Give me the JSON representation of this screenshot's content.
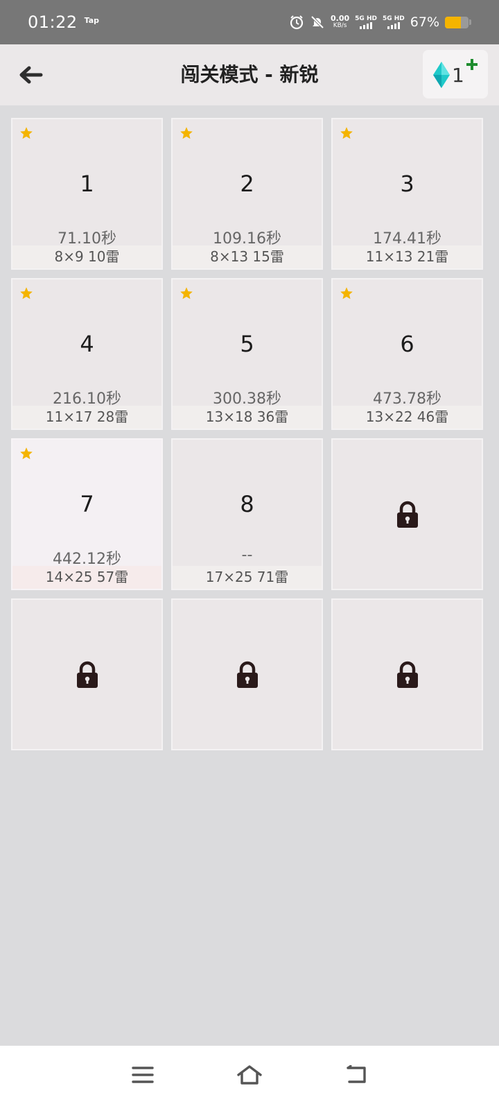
{
  "status_bar": {
    "time": "01:22",
    "app_tag": "Tap",
    "net_speed_value": "0.00",
    "net_speed_unit": "KB/s",
    "sim1_label": "5G HD",
    "sim2_label": "5G HD",
    "battery_percent": "67%",
    "battery_level": 0.67,
    "battery_color": "#f5b400",
    "icons": [
      "alarm-icon",
      "mute-bell-icon",
      "signal-icon",
      "battery-icon"
    ]
  },
  "header": {
    "back_icon": "arrow-left-icon",
    "title": "闯关模式 - 新锐",
    "gem_count": "1",
    "gem_icon": "diamond-icon",
    "gem_color": "#1fc9c9",
    "plus_icon": "plus-icon",
    "plus_color": "#1e8c2e"
  },
  "levels": [
    {
      "num": "1",
      "time": "71.10秒",
      "spec": "8×9  10雷",
      "starred": true,
      "locked": false,
      "active": false
    },
    {
      "num": "2",
      "time": "109.16秒",
      "spec": "8×13  15雷",
      "starred": true,
      "locked": false,
      "active": false
    },
    {
      "num": "3",
      "time": "174.41秒",
      "spec": "11×13  21雷",
      "starred": true,
      "locked": false,
      "active": false
    },
    {
      "num": "4",
      "time": "216.10秒",
      "spec": "11×17  28雷",
      "starred": true,
      "locked": false,
      "active": false
    },
    {
      "num": "5",
      "time": "300.38秒",
      "spec": "13×18  36雷",
      "starred": true,
      "locked": false,
      "active": false
    },
    {
      "num": "6",
      "time": "473.78秒",
      "spec": "13×22  46雷",
      "starred": true,
      "locked": false,
      "active": false
    },
    {
      "num": "7",
      "time": "442.12秒",
      "spec": "14×25  57雷",
      "starred": true,
      "locked": false,
      "active": true
    },
    {
      "num": "8",
      "time": "--",
      "spec": "17×25  71雷",
      "starred": false,
      "locked": false,
      "active": false
    },
    {
      "num": "",
      "time": "",
      "spec": "",
      "starred": false,
      "locked": true,
      "active": false
    },
    {
      "num": "",
      "time": "",
      "spec": "",
      "starred": false,
      "locked": true,
      "active": false
    },
    {
      "num": "",
      "time": "",
      "spec": "",
      "starred": false,
      "locked": true,
      "active": false
    },
    {
      "num": "",
      "time": "",
      "spec": "",
      "starred": false,
      "locked": true,
      "active": false
    }
  ],
  "colors": {
    "star": "#f4b400",
    "lock": "#2a1a1a"
  },
  "nav_bar": {
    "icons": [
      "menu-icon",
      "home-icon",
      "back-nav-icon"
    ]
  }
}
